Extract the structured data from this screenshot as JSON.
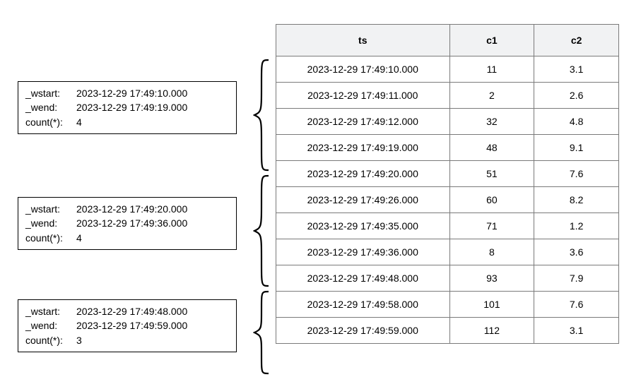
{
  "table": {
    "headers": {
      "ts": "ts",
      "c1": "c1",
      "c2": "c2"
    },
    "rows": [
      {
        "ts": "2023-12-29 17:49:10.000",
        "c1": "11",
        "c2": "3.1"
      },
      {
        "ts": "2023-12-29 17:49:11.000",
        "c1": "2",
        "c2": "2.6"
      },
      {
        "ts": "2023-12-29 17:49:12.000",
        "c1": "32",
        "c2": "4.8"
      },
      {
        "ts": "2023-12-29 17:49:19.000",
        "c1": "48",
        "c2": "9.1"
      },
      {
        "ts": "2023-12-29 17:49:20.000",
        "c1": "51",
        "c2": "7.6"
      },
      {
        "ts": "2023-12-29 17:49:26.000",
        "c1": "60",
        "c2": "8.2"
      },
      {
        "ts": "2023-12-29 17:49:35.000",
        "c1": "71",
        "c2": "1.2"
      },
      {
        "ts": "2023-12-29 17:49:36.000",
        "c1": "8",
        "c2": "3.6"
      },
      {
        "ts": "2023-12-29 17:49:48.000",
        "c1": "93",
        "c2": "7.9"
      },
      {
        "ts": "2023-12-29 17:49:58.000",
        "c1": "101",
        "c2": "7.6"
      },
      {
        "ts": "2023-12-29 17:49:59.000",
        "c1": "112",
        "c2": "3.1"
      }
    ]
  },
  "labels": {
    "wstart": "_wstart:",
    "wend": "_wend:",
    "count": "count(*):"
  },
  "windows": [
    {
      "wstart": "2023-12-29 17:49:10.000",
      "wend": "2023-12-29 17:49:19.000",
      "count": "4"
    },
    {
      "wstart": "2023-12-29 17:49:20.000",
      "wend": "2023-12-29 17:49:36.000",
      "count": "4"
    },
    {
      "wstart": "2023-12-29 17:49:48.000",
      "wend": "2023-12-29 17:49:59.000",
      "count": "3"
    }
  ]
}
